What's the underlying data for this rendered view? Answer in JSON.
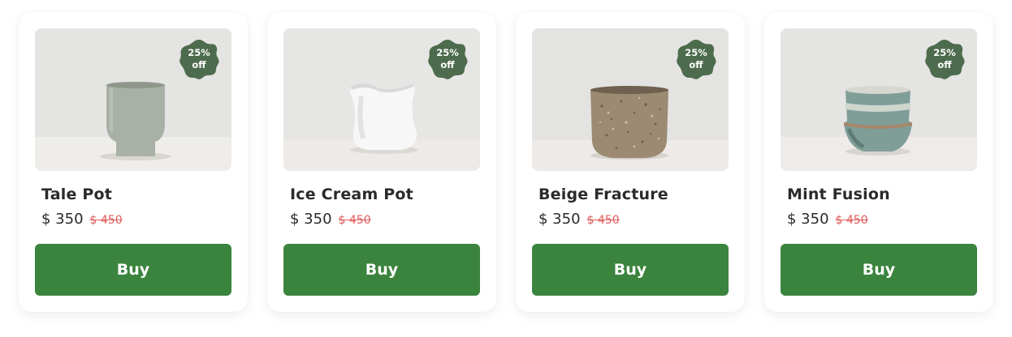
{
  "products": [
    {
      "name": "Tale Pot",
      "price": "$ 350",
      "old_price": "$ 450",
      "badge_line1": "25%",
      "badge_line2": "off",
      "buy_label": "Buy",
      "pot_color": "#a9b1a7"
    },
    {
      "name": "Ice Cream Pot",
      "price": "$ 350",
      "old_price": "$ 450",
      "badge_line1": "25%",
      "badge_line2": "off",
      "buy_label": "Buy",
      "pot_color": "#f7f7f7"
    },
    {
      "name": "Beige Fracture",
      "price": "$ 350",
      "old_price": "$ 450",
      "badge_line1": "25%",
      "badge_line2": "off",
      "buy_label": "Buy",
      "pot_color": "#9c8a73"
    },
    {
      "name": "Mint Fusion",
      "price": "$ 350",
      "old_price": "$ 450",
      "badge_line1": "25%",
      "badge_line2": "off",
      "buy_label": "Buy",
      "pot_color": "#7f9e98"
    }
  ],
  "colors": {
    "buy_button": "#3b843e",
    "badge": "#4d6b4d",
    "old_price": "#e05a5a",
    "text": "#2a2a2a"
  }
}
